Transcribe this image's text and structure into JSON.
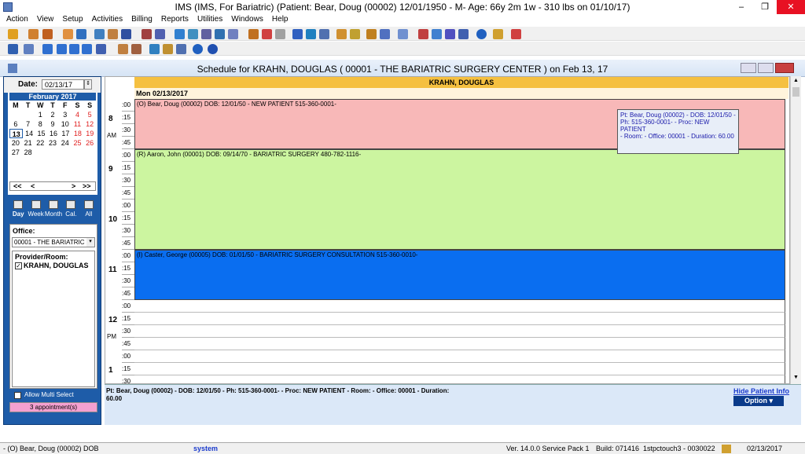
{
  "window": {
    "title": "IMS (IMS, For Bariatric)     (Patient: Bear, Doug  (00002) 12/01/1950 - M- Age: 66y 2m 1w - 310 lbs on 01/10/17)",
    "min": "–",
    "restore": "❐",
    "close": "✕"
  },
  "menu": [
    "Action",
    "View",
    "Setup",
    "Activities",
    "Billing",
    "Reports",
    "Utilities",
    "Windows",
    "Help"
  ],
  "schedule_title": "Schedule for KRAHN, DOUGLAS ( 00001 - THE BARIATRIC SURGERY CENTER )  on  Feb 13, 17",
  "date": {
    "label": "Date:",
    "value": "02/13/17"
  },
  "calendar": {
    "month": "February 2017",
    "days": [
      "M",
      "T",
      "W",
      "T",
      "F",
      "S",
      "S"
    ],
    "rows": [
      [
        "",
        "",
        "1",
        "2",
        "3",
        "4",
        "5"
      ],
      [
        "6",
        "7",
        "8",
        "9",
        "10",
        "11",
        "12"
      ],
      [
        "13",
        "14",
        "15",
        "16",
        "17",
        "18",
        "19"
      ],
      [
        "20",
        "21",
        "22",
        "23",
        "24",
        "25",
        "26"
      ],
      [
        "27",
        "28",
        "",
        "",
        "",
        "",
        ""
      ]
    ]
  },
  "nav": {
    "prev2": "<<",
    "prev": "<",
    "next": ">",
    "next2": ">>"
  },
  "views": [
    "Day",
    "Week",
    "Month",
    "Cal.",
    "All"
  ],
  "office": {
    "label": "Office:",
    "value": "00001 - THE BARIATRIC"
  },
  "provider": {
    "label": "Provider/Room:",
    "name": "KRAHN, DOUGLAS"
  },
  "allow_multi": "Allow Multi Select",
  "appt_count": "3 appointment(s)",
  "grid": {
    "provider": "KRAHN, DOUGLAS",
    "date": "Mon 02/13/2017",
    "hours": [
      {
        "h": "8",
        "ampm": "AM"
      },
      {
        "h": "9",
        "ampm": ""
      },
      {
        "h": "10",
        "ampm": ""
      },
      {
        "h": "11",
        "ampm": ""
      },
      {
        "h": "12",
        "ampm": "PM"
      },
      {
        "h": "1",
        "ampm": ""
      }
    ],
    "ticks": [
      ":00",
      ":15",
      ":30",
      ":45"
    ]
  },
  "appointments": [
    {
      "text": "(O)  Bear, Doug  (00002)  DOB: 12/01/50 -  NEW PATIENT     515-360-0001-",
      "color": "#f8b8b8",
      "fg": "#000"
    },
    {
      "text": "(R)  Aaron, John  (00001)  DOB: 09/14/70 -  BARIATRIC SURGERY     480-782-1116-",
      "color": "#ccf5a0",
      "fg": "#000"
    },
    {
      "text": "(I)  Caster, George  (00005)  DOB: 01/01/50 -  BARIATRIC SURGERY CONSULTATION      515-360-0010-",
      "color": "#0a6ef0",
      "fg": "#000"
    }
  ],
  "tooltip": {
    "l1": "Pt: Bear, Doug  (00002) - DOB: 12/01/50 -",
    "l2": "Ph: 515-360-0001-  - Proc: NEW PATIENT",
    "l3": "- Room:   - Office: 00001  - Duration: 60.00"
  },
  "info": {
    "text": "Pt: Bear, Doug  (00002) - DOB: 12/01/50 - Ph: 515-360-0001-  - Proc: NEW PATIENT - Room:   - Office: 00001  - Duration:",
    "text2": "60.00",
    "hide": "Hide Patient Info",
    "option": "Option"
  },
  "status": {
    "patient": "- (O) Bear, Doug (00002) DOB",
    "user": "system",
    "ver": "Ver. 14.0.0 Service Pack 1",
    "build": "Build: 071416",
    "station": "1stpctouch3 - 0030022",
    "date": "02/13/2017"
  }
}
